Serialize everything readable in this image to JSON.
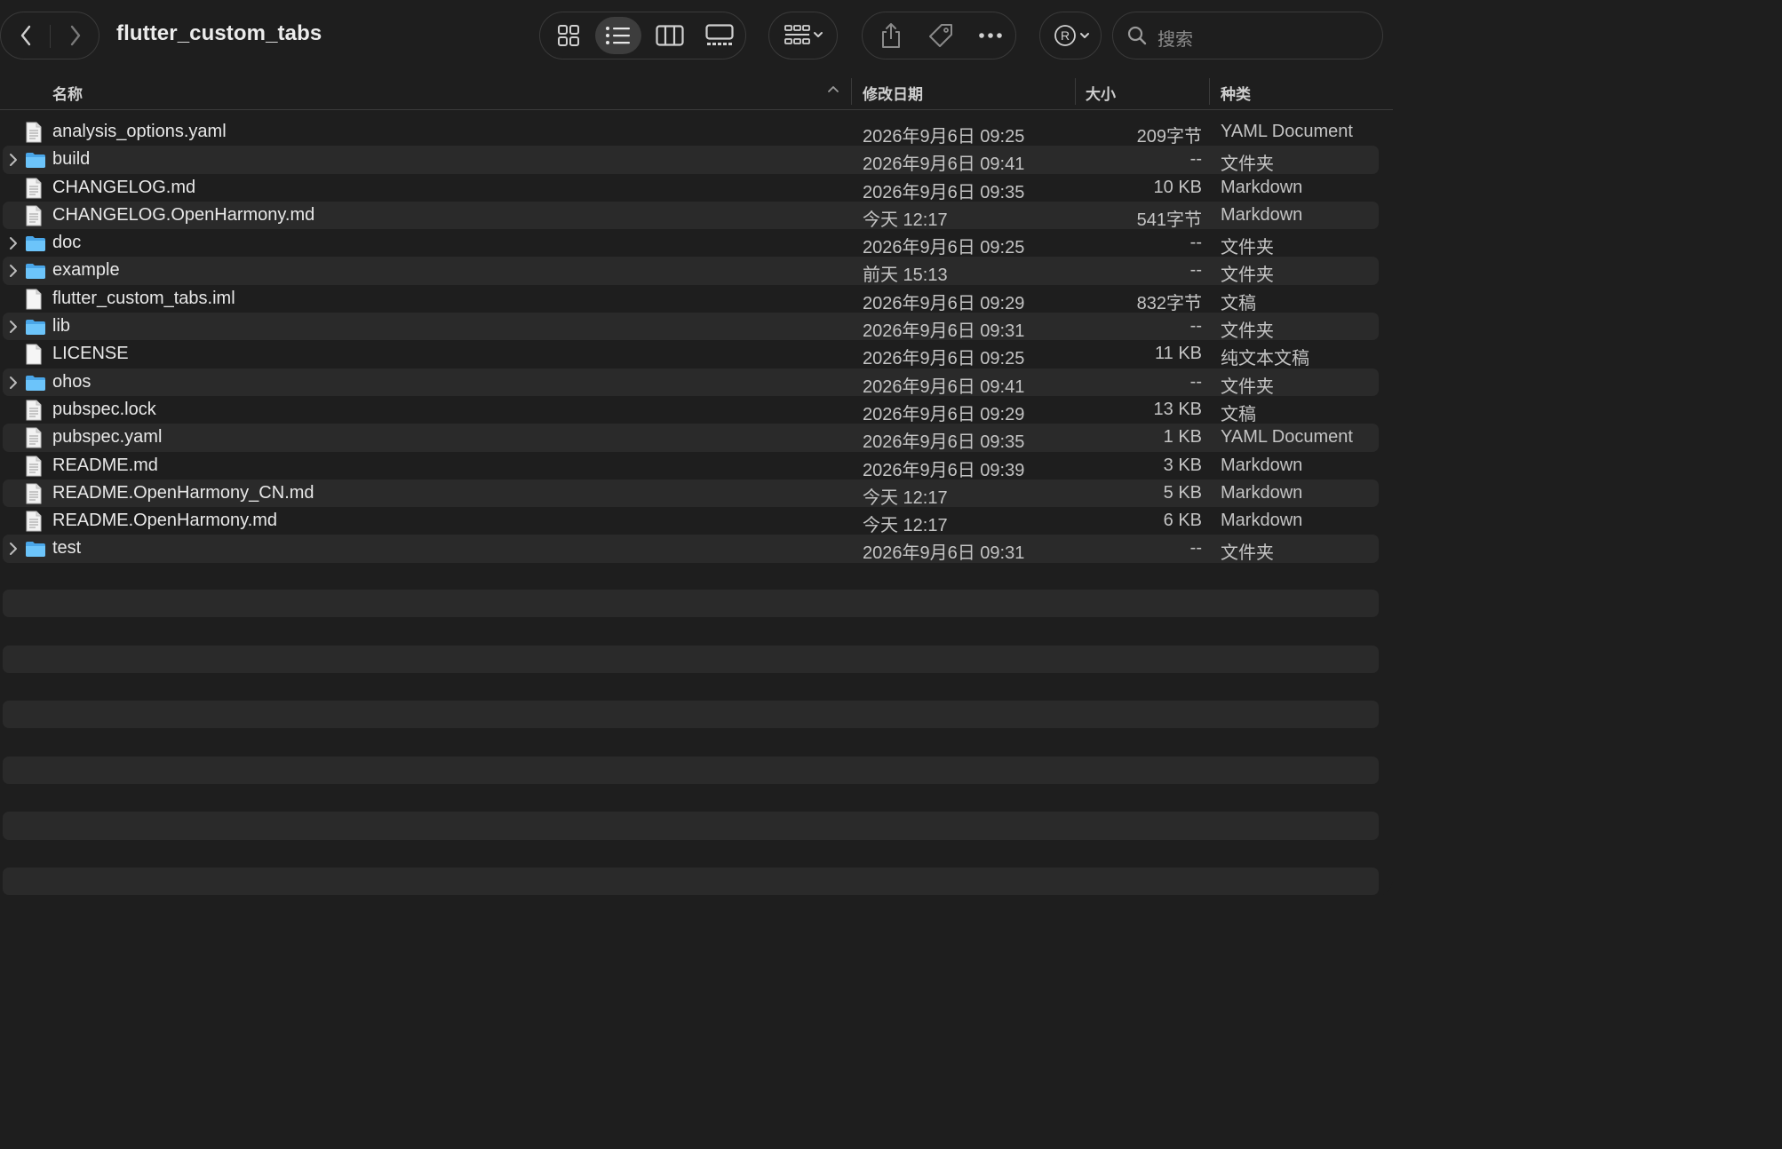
{
  "window": {
    "title": "flutter_custom_tabs"
  },
  "toolbar": {
    "back_icon": "chevron-left-icon",
    "forward_icon": "chevron-right-icon",
    "view_modes": [
      "icon-view",
      "list-view",
      "column-view",
      "gallery-view"
    ],
    "active_view": "list-view",
    "group_icon": "group-by-icon",
    "share_icon": "share-icon",
    "tag_icon": "tag-icon",
    "more_icon": "more-icon",
    "account_icon": "registered-icon",
    "search": {
      "placeholder": "搜索"
    }
  },
  "columns": {
    "name": "名称",
    "date": "修改日期",
    "size": "大小",
    "kind": "种类",
    "sort_indicator": "ascending"
  },
  "files": [
    {
      "name": "analysis_options.yaml",
      "date": "2026年9月6日 09:25",
      "size": "209字节",
      "kind": "YAML Document",
      "type": "file"
    },
    {
      "name": "build",
      "date": "2026年9月6日 09:41",
      "size": "--",
      "kind": "文件夹",
      "type": "folder"
    },
    {
      "name": "CHANGELOG.md",
      "date": "2026年9月6日 09:35",
      "size": "10 KB",
      "kind": "Markdown",
      "type": "file"
    },
    {
      "name": "CHANGELOG.OpenHarmony.md",
      "date": "今天 12:17",
      "size": "541字节",
      "kind": "Markdown",
      "type": "file"
    },
    {
      "name": "doc",
      "date": "2026年9月6日 09:25",
      "size": "--",
      "kind": "文件夹",
      "type": "folder"
    },
    {
      "name": "example",
      "date": "前天 15:13",
      "size": "--",
      "kind": "文件夹",
      "type": "folder"
    },
    {
      "name": "flutter_custom_tabs.iml",
      "date": "2026年9月6日 09:29",
      "size": "832字节",
      "kind": "文稿",
      "type": "file-blank"
    },
    {
      "name": "lib",
      "date": "2026年9月6日 09:31",
      "size": "--",
      "kind": "文件夹",
      "type": "folder"
    },
    {
      "name": "LICENSE",
      "date": "2026年9月6日 09:25",
      "size": "11 KB",
      "kind": "纯文本文稿",
      "type": "file-blank"
    },
    {
      "name": "ohos",
      "date": "2026年9月6日 09:41",
      "size": "--",
      "kind": "文件夹",
      "type": "folder"
    },
    {
      "name": "pubspec.lock",
      "date": "2026年9月6日 09:29",
      "size": "13 KB",
      "kind": "文稿",
      "type": "file"
    },
    {
      "name": "pubspec.yaml",
      "date": "2026年9月6日 09:35",
      "size": "1 KB",
      "kind": "YAML Document",
      "type": "file"
    },
    {
      "name": "README.md",
      "date": "2026年9月6日 09:39",
      "size": "3 KB",
      "kind": "Markdown",
      "type": "file"
    },
    {
      "name": "README.OpenHarmony_CN.md",
      "date": "今天 12:17",
      "size": "5 KB",
      "kind": "Markdown",
      "type": "file"
    },
    {
      "name": "README.OpenHarmony.md",
      "date": "今天 12:17",
      "size": "6 KB",
      "kind": "Markdown",
      "type": "file"
    },
    {
      "name": "test",
      "date": "2026年9月6日 09:31",
      "size": "--",
      "kind": "文件夹",
      "type": "folder"
    }
  ],
  "colors": {
    "background": "#1e1e1e",
    "row_stripe": "#2a2a2a",
    "folder": "#5ab8f5",
    "text": "#e8e8e8",
    "secondary_text": "#c4c4c4"
  }
}
